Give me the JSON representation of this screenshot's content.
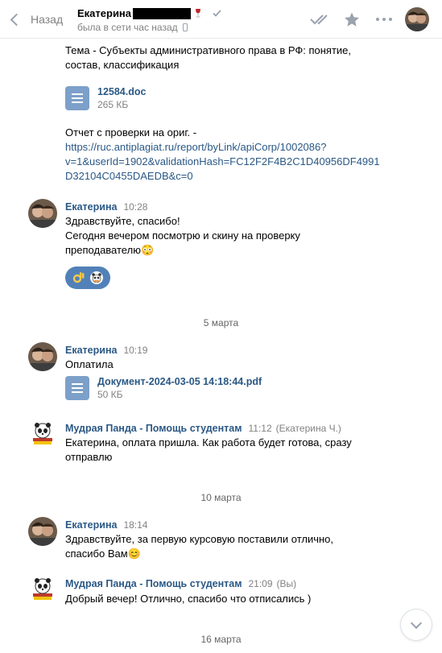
{
  "header": {
    "back_label": "Назад",
    "peer_name": "Екатерина",
    "peer_status": "была в сети час назад",
    "icons": [
      "back-chevron-icon",
      "wine-glass-icon",
      "verified-check-icon",
      "phone-icon",
      "double-check-icon",
      "star-icon",
      "more-icon",
      "avatar"
    ]
  },
  "messages": {
    "m0": {
      "line1": "Тема - Субъекты административного права в РФ: понятие,",
      "line2": "состав, классификация",
      "doc_name": "12584.doc",
      "doc_size": "265 КБ",
      "report_label": "Отчет с проверки на ориг. -",
      "link_line1": "https://ruc.antiplagiat.ru/report/byLink/apiCorp/1002086?",
      "link_line2": "v=1&userId=1902&validationHash=FC12F2F4B2C1D40956DF4991",
      "link_line3": "D32104C0455DAEDB&c=0"
    },
    "m1": {
      "author": "Екатерина",
      "time": "10:28",
      "line1": "Здравствуйте, спасибо!",
      "line2": "Сегодня вечером посмотрю и скину на проверку",
      "line3": "преподавателю",
      "emoji": "😳",
      "reactions": [
        "ok-hand-emoji",
        "reactor-avatar"
      ]
    },
    "date1": "5 марта",
    "m2": {
      "author": "Екатерина",
      "time": "10:19",
      "line1": "Оплатила",
      "doc_name": "Документ-2024-03-05 14:18:44.pdf",
      "doc_size": "50 КБ"
    },
    "m3": {
      "author": "Мудрая Панда - Помощь студентам",
      "time": "11:12",
      "extra": "(Екатерина Ч.)",
      "line1": "Екатерина, оплата пришла. Как работа будет готова, сразу",
      "line2": "отправлю"
    },
    "date2": "10 марта",
    "m4": {
      "author": "Екатерина",
      "time": "18:14",
      "line1": "Здравствуйте, за первую курсовую поставили отлично,",
      "line2": "спасибо Вам",
      "emoji": "😊"
    },
    "m5": {
      "author": "Мудрая Панда - Помощь студентам",
      "time": "21:09",
      "extra": "(Вы)",
      "line1": "Добрый вечер! Отлично, спасибо что отписались )"
    },
    "date3": "16 марта"
  },
  "colors": {
    "link": "#2a5885",
    "muted": "#828282",
    "accent": "#5181b8",
    "icon": "#99a2ad"
  }
}
